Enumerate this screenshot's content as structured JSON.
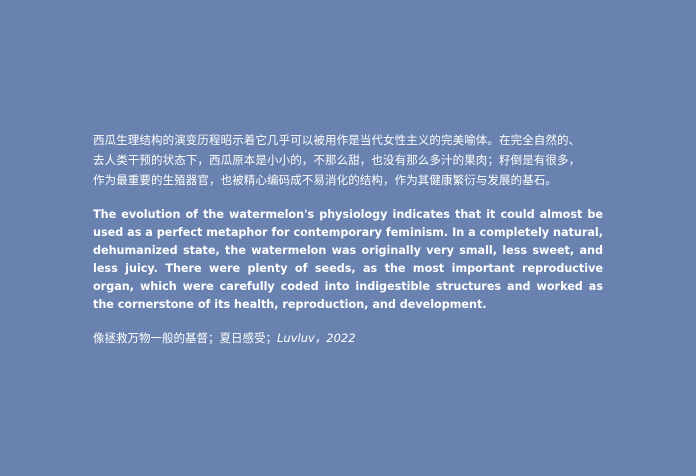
{
  "text": {
    "zh_paragraph": "西瓜生理结构的演变历程昭示着它几乎可以被用作是当代女性主义的完美喻体。在完全自然的、\n去人类干预的状态下，西瓜原本是小小的，不那么甜，也没有那么多汁的果肉；籽倒是有很多，\n作为最重要的生殖器官，也被精心编码成不易消化的结构，作为其健康繁衍与发展的基石。",
    "en_paragraph": "The evolution of the watermelon's physiology indicates that it could almost be used as a perfect metaphor for contemporary feminism. In a completely natural, dehumanized state, the watermelon was originally very small, less sweet, and less juicy. There were plenty of seeds, as the most important reproductive organ, which were carefully coded into indigestible structures and worked as the cornerstone of its health, reproduction, and development.",
    "credit_zh": "像拯救万物一般的基督；夏日感受；",
    "credit_en": "Luvluv，2022"
  },
  "colors": {
    "background": "#6982b0",
    "text": "#ffffff"
  }
}
